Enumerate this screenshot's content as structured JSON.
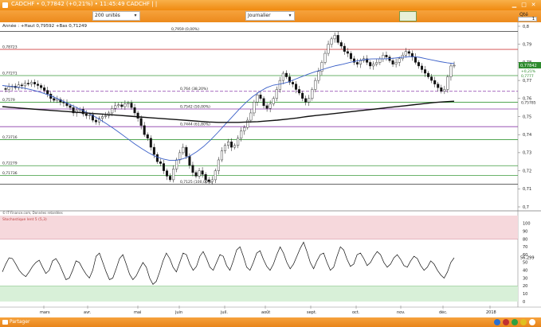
{
  "window": {
    "title": "CADCHF • 0,77842 (+0,21%) • 11:45:49 CADCHF | |",
    "units": "200 unités",
    "period": "Journalier",
    "qty_label": "Qté",
    "qty_value": "1",
    "share_label": "Partager"
  },
  "header": {
    "summary": "Année : +Haut 0,79592 +Bas 0,71249",
    "source": "© IT-Finance.com, Données retardées",
    "indicator": "Stochastique lent 5 (5,3)"
  },
  "chart_data": [
    {
      "type": "candlestick",
      "x_ticks": [
        "mars",
        "avr.",
        "mai",
        "juin",
        "juil.",
        "août",
        "sept.",
        "oct.",
        "nov.",
        "déc.",
        "2018"
      ],
      "y_ticks": [
        "0,8",
        "0,79",
        "0,78",
        "0,77",
        "0,76",
        "0,75",
        "0,74",
        "0,73",
        "0,72",
        "0,71",
        "0,7"
      ],
      "ylim": [
        0.7,
        0.8
      ],
      "grid": false,
      "close_series": [
        0.7655,
        0.765,
        0.7665,
        0.7668,
        0.766,
        0.7675,
        0.767,
        0.7685,
        0.768,
        0.769,
        0.768,
        0.7672,
        0.766,
        0.7645,
        0.7625,
        0.76,
        0.759,
        0.7595,
        0.758,
        0.7575,
        0.756,
        0.755,
        0.752,
        0.7535,
        0.754,
        0.7515,
        0.7505,
        0.751,
        0.748,
        0.747,
        0.749,
        0.75,
        0.7505,
        0.752,
        0.7545,
        0.756,
        0.7565,
        0.7555,
        0.757,
        0.7575,
        0.755,
        0.752,
        0.749,
        0.745,
        0.74,
        0.738,
        0.733,
        0.729,
        0.725,
        0.724,
        0.72,
        0.717,
        0.715,
        0.721,
        0.726,
        0.73,
        0.733,
        0.728,
        0.723,
        0.719,
        0.717,
        0.72,
        0.718,
        0.715,
        0.714,
        0.715,
        0.72,
        0.726,
        0.731,
        0.734,
        0.736,
        0.733,
        0.734,
        0.738,
        0.742,
        0.744,
        0.748,
        0.752,
        0.758,
        0.762,
        0.76,
        0.756,
        0.7545,
        0.757,
        0.76,
        0.765,
        0.77,
        0.774,
        0.772,
        0.769,
        0.768,
        0.765,
        0.763,
        0.76,
        0.758,
        0.76,
        0.765,
        0.77,
        0.775,
        0.78,
        0.785,
        0.79,
        0.793,
        0.795,
        0.791,
        0.789,
        0.786,
        0.785,
        0.782,
        0.78,
        0.779,
        0.781,
        0.782,
        0.78,
        0.778,
        0.779,
        0.78,
        0.782,
        0.784,
        0.783,
        0.781,
        0.779,
        0.78,
        0.782,
        0.784,
        0.786,
        0.785,
        0.783,
        0.78,
        0.778,
        0.776,
        0.774,
        0.772,
        0.77,
        0.768,
        0.766,
        0.764,
        0.765,
        0.772,
        0.778,
        0.7784
      ],
      "moving_averages": [
        {
          "color": "#3a5fc8",
          "values": [
            0.7672,
            0.7668,
            0.7664,
            0.7658,
            0.765,
            0.764,
            0.7628,
            0.7614,
            0.7598,
            0.758,
            0.7562,
            0.7544,
            0.7526,
            0.7506,
            0.7484,
            0.746,
            0.7434,
            0.7406,
            0.7378,
            0.735,
            0.7324,
            0.73,
            0.728,
            0.7266,
            0.7258,
            0.7258,
            0.7266,
            0.7282,
            0.7306,
            0.7336,
            0.7372,
            0.7412,
            0.7454,
            0.7496,
            0.7538,
            0.7576,
            0.761,
            0.7638,
            0.766,
            0.7674,
            0.768,
            0.769,
            0.7705,
            0.772,
            0.7735,
            0.7748,
            0.776,
            0.7772,
            0.7782,
            0.779,
            0.78,
            0.7808,
            0.7815,
            0.7819,
            0.782,
            0.782,
            0.7822,
            0.7826,
            0.783,
            0.7832,
            0.7828,
            0.782,
            0.7812,
            0.7804,
            0.7798,
            0.7793
          ]
        },
        {
          "color": "#111111",
          "values": [
            0.7555,
            0.755,
            0.7546,
            0.7542,
            0.7538,
            0.7534,
            0.753,
            0.7526,
            0.7522,
            0.7518,
            0.7514,
            0.751,
            0.7506,
            0.7502,
            0.7498,
            0.7494,
            0.749,
            0.7486,
            0.7482,
            0.7478,
            0.7474,
            0.747,
            0.7468,
            0.7468,
            0.7468,
            0.747,
            0.7472,
            0.7476,
            0.748,
            0.7486,
            0.7492,
            0.75,
            0.7506,
            0.7512,
            0.7518,
            0.7524,
            0.753,
            0.7536,
            0.7542,
            0.7548,
            0.7554,
            0.756,
            0.7566,
            0.7572,
            0.7578,
            0.7582,
            0.7585
          ]
        }
      ],
      "levels": [
        {
          "value": 0.7972,
          "color": "#333333",
          "dash": false,
          "label": "0,7959 (0,00%)"
        },
        {
          "value": 0.7872,
          "color": "#d04040",
          "dash": false,
          "label": "0,78723"
        },
        {
          "value": 0.7727,
          "color": "#3a9a3a",
          "dash": false,
          "label": "0,77271"
        },
        {
          "value": 0.764,
          "color": "#8a3aaa",
          "dash": true,
          "label": "0,764 (38,20%)"
        },
        {
          "value": 0.7579,
          "color": "#3a9a3a",
          "dash": false,
          "label": "0,7579"
        },
        {
          "value": 0.7542,
          "color": "#8a3aaa",
          "dash": false,
          "label": "0,7542 (50,00%)"
        },
        {
          "value": 0.7444,
          "color": "#8a3aaa",
          "dash": false,
          "label": "0,7444 (61,80%)"
        },
        {
          "value": 0.7372,
          "color": "#3a9a3a",
          "dash": false,
          "label": "0,73716"
        },
        {
          "value": 0.7228,
          "color": "#3a9a3a",
          "dash": false,
          "label": "0,72279"
        },
        {
          "value": 0.7174,
          "color": "#3a9a3a",
          "dash": false,
          "label": "0,71736"
        },
        {
          "value": 0.7125,
          "color": "#333333",
          "dash": false,
          "label": "0,7125 (100,00%)"
        }
      ],
      "last_price_label": "0,77842",
      "change_label": "+0,21%",
      "extra_right_labels": [
        "0,7777",
        "0,75785"
      ]
    },
    {
      "type": "line",
      "name": "Stochastique lent 5 (5,3)",
      "ylim": [
        0,
        110
      ],
      "y_ticks": [
        "100",
        "90",
        "80",
        "70",
        "60",
        "50",
        "40",
        "30",
        "20",
        "10",
        "0"
      ],
      "last_value_label": "56,299",
      "overbought": 80,
      "oversold": 20,
      "values": [
        38,
        48,
        56,
        55,
        48,
        40,
        35,
        32,
        38,
        45,
        50,
        53,
        44,
        36,
        40,
        52,
        55,
        48,
        38,
        28,
        30,
        40,
        52,
        50,
        42,
        35,
        30,
        40,
        58,
        62,
        50,
        38,
        28,
        30,
        42,
        55,
        60,
        48,
        35,
        28,
        33,
        42,
        50,
        44,
        30,
        22,
        26,
        38,
        52,
        62,
        55,
        44,
        38,
        50,
        62,
        60,
        48,
        40,
        45,
        58,
        64,
        55,
        44,
        40,
        50,
        60,
        58,
        46,
        40,
        52,
        66,
        70,
        58,
        44,
        40,
        50,
        62,
        65,
        54,
        45,
        40,
        48,
        60,
        70,
        62,
        50,
        42,
        48,
        58,
        68,
        76,
        64,
        50,
        42,
        52,
        60,
        62,
        50,
        40,
        44,
        58,
        70,
        66,
        54,
        45,
        48,
        60,
        62,
        55,
        46,
        50,
        58,
        64,
        60,
        50,
        44,
        48,
        56,
        60,
        54,
        46,
        44,
        52,
        58,
        55,
        46,
        40,
        44,
        52,
        48,
        40,
        34,
        30,
        38,
        50,
        56
      ]
    }
  ]
}
